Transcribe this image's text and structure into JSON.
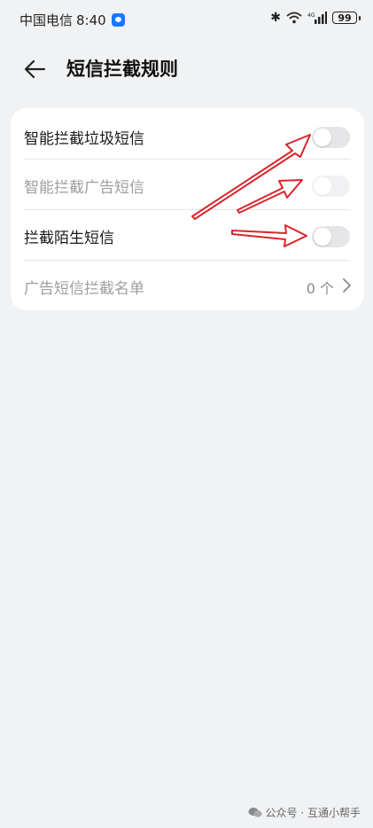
{
  "status_bar": {
    "carrier": "中国电信",
    "time": "8:40",
    "battery": "99"
  },
  "header": {
    "title": "短信拦截规则"
  },
  "settings": {
    "rows": [
      {
        "label": "智能拦截垃圾短信",
        "enabled": false,
        "disabled": false
      },
      {
        "label": "智能拦截广告短信",
        "enabled": false,
        "disabled": true
      },
      {
        "label": "拦截陌生短信",
        "enabled": false,
        "disabled": false
      },
      {
        "label": "广告短信拦截名单",
        "value": "0 个"
      }
    ]
  },
  "watermark": {
    "text": "公众号 · 互通小帮手"
  },
  "colors": {
    "background": "#f1f2f4",
    "annotation_arrow": "#d9262c",
    "toggle_off": "#e6e6e8"
  },
  "icons": [
    "back-arrow-icon",
    "bluetooth-icon",
    "wifi-icon",
    "signal-icon",
    "battery-icon",
    "chevron-right-icon",
    "wechat-icon"
  ]
}
